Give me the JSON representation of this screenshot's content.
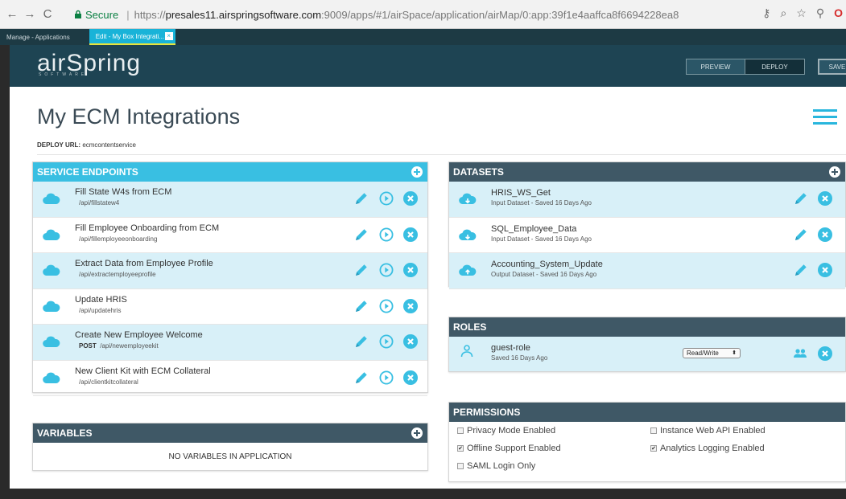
{
  "browser": {
    "secure_label": "Secure",
    "url_scheme": "https://",
    "url_host": "presales11.airspringsoftware.com",
    "url_rest": ":9009/apps/#1/airSpace/application/airMap/0:app:39f1e4aaffca8f6694228ea8"
  },
  "app_tabs": [
    {
      "label": "Manage - Applications"
    },
    {
      "label": "Edit - My Box Integrati..."
    }
  ],
  "header": {
    "logo": "airSpring",
    "logo_sub": "SOFTWARE",
    "preview_label": "PREVIEW",
    "deploy_label": "DEPLOY",
    "save_label": "SAVE"
  },
  "page": {
    "title": "My ECM Integrations",
    "deploy_url_label": "DEPLOY URL:",
    "deploy_url_value": "ecmcontentservice"
  },
  "service_endpoints": {
    "title": "SERVICE ENDPOINTS",
    "items": [
      {
        "name": "Fill State W4s from ECM",
        "method": "",
        "path": "/api/fillstatew4"
      },
      {
        "name": "Fill Employee Onboarding from ECM",
        "method": "",
        "path": "/api/fillemployeeonboarding"
      },
      {
        "name": "Extract Data from Employee Profile",
        "method": "",
        "path": "/api/extractemployeeprofile"
      },
      {
        "name": "Update HRIS",
        "method": "",
        "path": "/api/updatehris"
      },
      {
        "name": "Create New Employee Welcome",
        "method": "POST",
        "path": "/api/newemployeekit"
      },
      {
        "name": "New Client Kit with ECM Collateral",
        "method": "",
        "path": "/api/clientkitcollateral"
      }
    ]
  },
  "variables": {
    "title": "VARIABLES",
    "empty_text": "NO VARIABLES IN APPLICATION"
  },
  "datasets": {
    "title": "DATASETS",
    "items": [
      {
        "name": "HRIS_WS_Get",
        "info": "Input Dataset - Saved 16 Days Ago"
      },
      {
        "name": "SQL_Employee_Data",
        "info": "Input Dataset - Saved 16 Days Ago"
      },
      {
        "name": "Accounting_System_Update",
        "info": "Output Dataset - Saved 16 Days Ago"
      }
    ]
  },
  "roles": {
    "title": "ROLES",
    "items": [
      {
        "name": "guest-role",
        "info": "Saved 16 Days Ago",
        "access": "Read/Write"
      }
    ]
  },
  "permissions": {
    "title": "PERMISSIONS",
    "items": [
      {
        "label": "Privacy Mode Enabled",
        "checked": false
      },
      {
        "label": "Instance Web API Enabled",
        "checked": false
      },
      {
        "label": "Offline Support Enabled",
        "checked": true
      },
      {
        "label": "Analytics Logging Enabled",
        "checked": true
      },
      {
        "label": "SAML Login Only",
        "checked": false
      }
    ]
  },
  "colors": {
    "accent": "#39bfe2",
    "dark_panel": "#3f5866",
    "header_bg": "#1e4453",
    "row_alt": "#d8f0f8"
  }
}
